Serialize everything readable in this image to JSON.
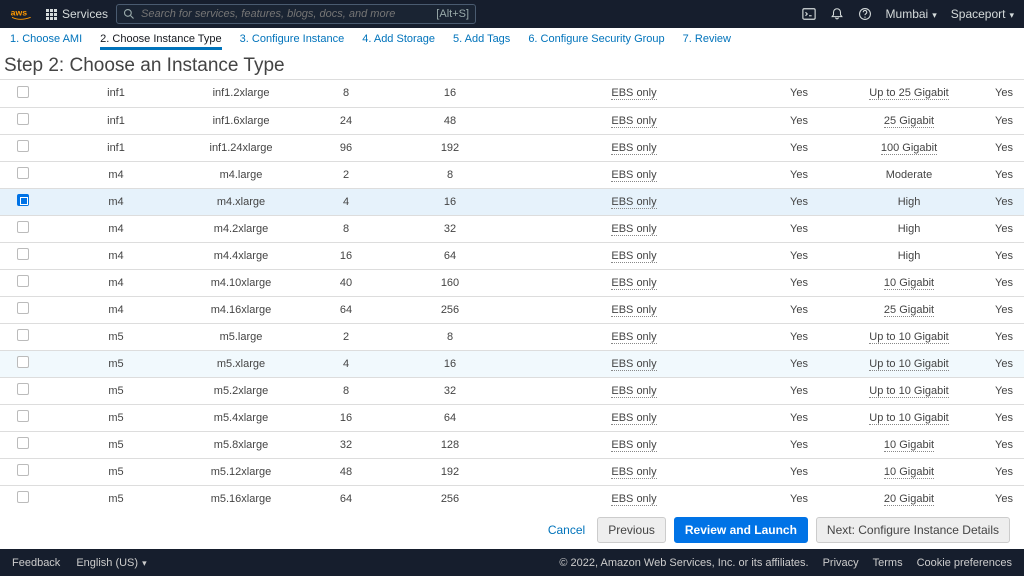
{
  "topnav": {
    "services_label": "Services",
    "search_placeholder": "Search for services, features, blogs, docs, and more",
    "search_hotkey": "[Alt+S]",
    "region": "Mumbai",
    "account": "Spaceport"
  },
  "wizard": {
    "steps": [
      {
        "label": "1. Choose AMI"
      },
      {
        "label": "2. Choose Instance Type"
      },
      {
        "label": "3. Configure Instance"
      },
      {
        "label": "4. Add Storage"
      },
      {
        "label": "5. Add Tags"
      },
      {
        "label": "6. Configure Security Group"
      },
      {
        "label": "7. Review"
      }
    ],
    "active_index": 1
  },
  "heading": "Step 2: Choose an Instance Type",
  "rows": [
    {
      "selected": false,
      "family": "inf1",
      "type": "inf1.2xlarge",
      "vcpus": "8",
      "memory": "16",
      "storage": "EBS only",
      "ebs_opt": "Yes",
      "network": "Up to 25 Gigabit",
      "net_dotted": true,
      "ipv6": "Yes"
    },
    {
      "selected": false,
      "family": "inf1",
      "type": "inf1.6xlarge",
      "vcpus": "24",
      "memory": "48",
      "storage": "EBS only",
      "ebs_opt": "Yes",
      "network": "25 Gigabit",
      "net_dotted": true,
      "ipv6": "Yes"
    },
    {
      "selected": false,
      "family": "inf1",
      "type": "inf1.24xlarge",
      "vcpus": "96",
      "memory": "192",
      "storage": "EBS only",
      "ebs_opt": "Yes",
      "network": "100 Gigabit",
      "net_dotted": true,
      "ipv6": "Yes"
    },
    {
      "selected": false,
      "family": "m4",
      "type": "m4.large",
      "vcpus": "2",
      "memory": "8",
      "storage": "EBS only",
      "ebs_opt": "Yes",
      "network": "Moderate",
      "net_dotted": false,
      "ipv6": "Yes"
    },
    {
      "selected": true,
      "family": "m4",
      "type": "m4.xlarge",
      "vcpus": "4",
      "memory": "16",
      "storage": "EBS only",
      "ebs_opt": "Yes",
      "network": "High",
      "net_dotted": false,
      "ipv6": "Yes"
    },
    {
      "selected": false,
      "family": "m4",
      "type": "m4.2xlarge",
      "vcpus": "8",
      "memory": "32",
      "storage": "EBS only",
      "ebs_opt": "Yes",
      "network": "High",
      "net_dotted": false,
      "ipv6": "Yes"
    },
    {
      "selected": false,
      "family": "m4",
      "type": "m4.4xlarge",
      "vcpus": "16",
      "memory": "64",
      "storage": "EBS only",
      "ebs_opt": "Yes",
      "network": "High",
      "net_dotted": false,
      "ipv6": "Yes"
    },
    {
      "selected": false,
      "family": "m4",
      "type": "m4.10xlarge",
      "vcpus": "40",
      "memory": "160",
      "storage": "EBS only",
      "ebs_opt": "Yes",
      "network": "10 Gigabit",
      "net_dotted": true,
      "ipv6": "Yes"
    },
    {
      "selected": false,
      "family": "m4",
      "type": "m4.16xlarge",
      "vcpus": "64",
      "memory": "256",
      "storage": "EBS only",
      "ebs_opt": "Yes",
      "network": "25 Gigabit",
      "net_dotted": true,
      "ipv6": "Yes"
    },
    {
      "selected": false,
      "family": "m5",
      "type": "m5.large",
      "vcpus": "2",
      "memory": "8",
      "storage": "EBS only",
      "ebs_opt": "Yes",
      "network": "Up to 10 Gigabit",
      "net_dotted": true,
      "ipv6": "Yes"
    },
    {
      "selected": false,
      "hover": true,
      "family": "m5",
      "type": "m5.xlarge",
      "vcpus": "4",
      "memory": "16",
      "storage": "EBS only",
      "ebs_opt": "Yes",
      "network": "Up to 10 Gigabit",
      "net_dotted": true,
      "ipv6": "Yes"
    },
    {
      "selected": false,
      "family": "m5",
      "type": "m5.2xlarge",
      "vcpus": "8",
      "memory": "32",
      "storage": "EBS only",
      "ebs_opt": "Yes",
      "network": "Up to 10 Gigabit",
      "net_dotted": true,
      "ipv6": "Yes"
    },
    {
      "selected": false,
      "family": "m5",
      "type": "m5.4xlarge",
      "vcpus": "16",
      "memory": "64",
      "storage": "EBS only",
      "ebs_opt": "Yes",
      "network": "Up to 10 Gigabit",
      "net_dotted": true,
      "ipv6": "Yes"
    },
    {
      "selected": false,
      "family": "m5",
      "type": "m5.8xlarge",
      "vcpus": "32",
      "memory": "128",
      "storage": "EBS only",
      "ebs_opt": "Yes",
      "network": "10 Gigabit",
      "net_dotted": true,
      "ipv6": "Yes"
    },
    {
      "selected": false,
      "family": "m5",
      "type": "m5.12xlarge",
      "vcpus": "48",
      "memory": "192",
      "storage": "EBS only",
      "ebs_opt": "Yes",
      "network": "10 Gigabit",
      "net_dotted": true,
      "ipv6": "Yes"
    },
    {
      "selected": false,
      "family": "m5",
      "type": "m5.16xlarge",
      "vcpus": "64",
      "memory": "256",
      "storage": "EBS only",
      "ebs_opt": "Yes",
      "network": "20 Gigabit",
      "net_dotted": true,
      "ipv6": "Yes"
    }
  ],
  "actionbar": {
    "cancel": "Cancel",
    "previous": "Previous",
    "review": "Review and Launch",
    "next": "Next: Configure Instance Details"
  },
  "footer": {
    "feedback": "Feedback",
    "language": "English (US)",
    "copyright": "© 2022, Amazon Web Services, Inc. or its affiliates.",
    "privacy": "Privacy",
    "terms": "Terms",
    "cookie": "Cookie preferences"
  }
}
